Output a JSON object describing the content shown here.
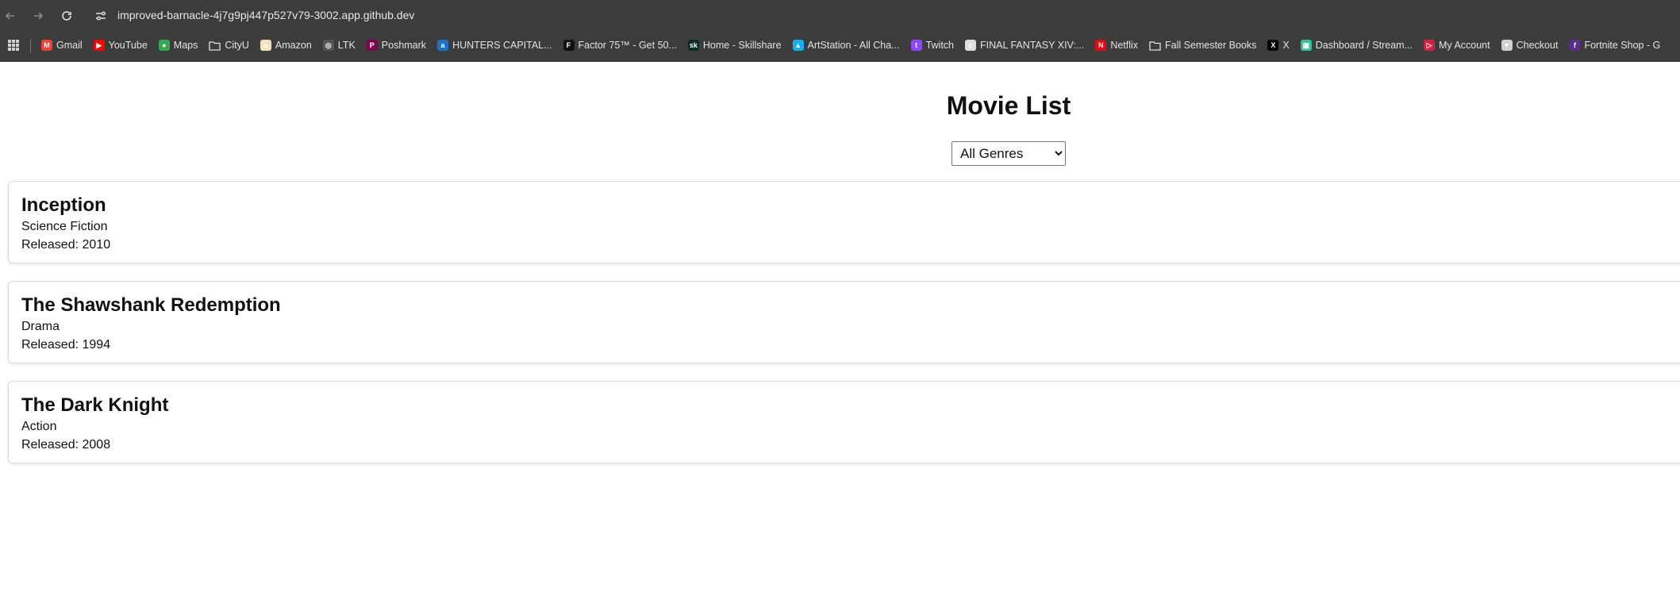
{
  "browser": {
    "url": "improved-barnacle-4j7g9pj447p527v79-3002.app.github.dev",
    "bookmarks": [
      {
        "label": "Gmail",
        "icon": "gmail-icon",
        "color": "#ea4335",
        "glyph": "M"
      },
      {
        "label": "YouTube",
        "icon": "youtube-icon",
        "color": "#ff0000",
        "glyph": "▶"
      },
      {
        "label": "Maps",
        "icon": "maps-icon",
        "color": "#34a853",
        "glyph": "●"
      },
      {
        "label": "CityU",
        "icon": "folder-icon",
        "color": "#e3e3e3",
        "glyph": ""
      },
      {
        "label": "Amazon",
        "icon": "amazon-icon",
        "color": "#f3e2c0",
        "glyph": "a"
      },
      {
        "label": "LTK",
        "icon": "ltk-icon",
        "color": "#555555",
        "glyph": "◎"
      },
      {
        "label": "Poshmark",
        "icon": "poshmark-icon",
        "color": "#7f0353",
        "glyph": "P"
      },
      {
        "label": "HUNTERS CAPITAL...",
        "icon": "hunters-capital-icon",
        "color": "#1a73c8",
        "glyph": "a"
      },
      {
        "label": "Factor 75™ - Get 50...",
        "icon": "factor-icon",
        "color": "#111111",
        "glyph": "F"
      },
      {
        "label": "Home - Skillshare",
        "icon": "skillshare-icon",
        "color": "#0b2b26",
        "glyph": "sk"
      },
      {
        "label": "ArtStation - All Cha...",
        "icon": "artstation-icon",
        "color": "#13aff0",
        "glyph": "▲"
      },
      {
        "label": "Twitch",
        "icon": "twitch-icon",
        "color": "#9146ff",
        "glyph": "t"
      },
      {
        "label": "FINAL FANTASY XIV:...",
        "icon": "ffxiv-icon",
        "color": "#dddddd",
        "glyph": "c"
      },
      {
        "label": "Netflix",
        "icon": "netflix-icon",
        "color": "#e50914",
        "glyph": "N"
      },
      {
        "label": "Fall Semester Books",
        "icon": "folder-icon",
        "color": "#e3e3e3",
        "glyph": ""
      },
      {
        "label": "X",
        "icon": "x-icon",
        "color": "#000000",
        "glyph": "X"
      },
      {
        "label": "Dashboard / Stream...",
        "icon": "streamlabs-icon",
        "color": "#31c3a2",
        "glyph": "▣"
      },
      {
        "label": "My Account",
        "icon": "account-icon",
        "color": "#d4213d",
        "glyph": "▷"
      },
      {
        "label": "Checkout",
        "icon": "checkout-icon",
        "color": "#cfcfcf",
        "glyph": "▼"
      },
      {
        "label": "Fortnite Shop - G",
        "icon": "fortnite-icon",
        "color": "#5b2d8e",
        "glyph": "f"
      }
    ]
  },
  "page": {
    "title": "Movie List",
    "genre_filter": {
      "selected": "All Genres"
    }
  },
  "movies": [
    {
      "title": "Inception",
      "genre": "Science Fiction",
      "released": "Released: 2010"
    },
    {
      "title": "The Shawshank Redemption",
      "genre": "Drama",
      "released": "Released: 1994"
    },
    {
      "title": "The Dark Knight",
      "genre": "Action",
      "released": "Released: 2008"
    }
  ]
}
